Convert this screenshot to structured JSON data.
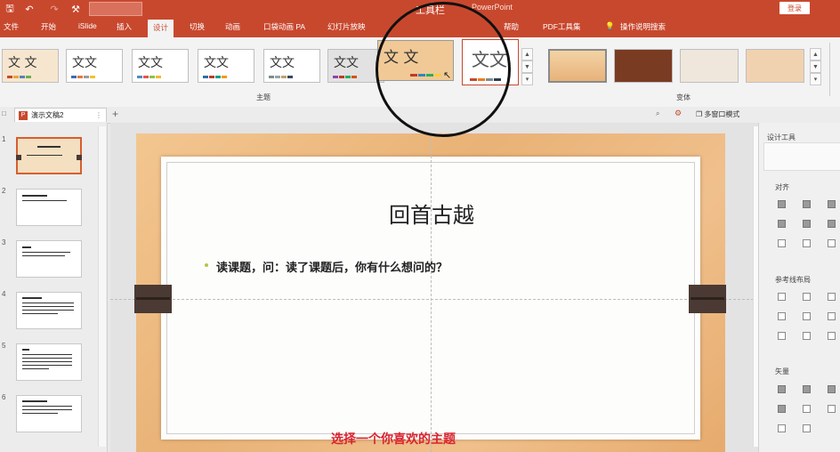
{
  "titlebar": {
    "tools_label": "工具栏",
    "app_name": "PowerPoint",
    "login_label": "登录",
    "quick_access": [
      "save-icon",
      "undo-icon",
      "redo-icon",
      "format-painter-icon"
    ]
  },
  "tabs": [
    {
      "label": "文件"
    },
    {
      "label": "开始"
    },
    {
      "label": "iSlide"
    },
    {
      "label": "插入"
    },
    {
      "label": "设计",
      "active": true
    },
    {
      "label": "切换"
    },
    {
      "label": "动画"
    },
    {
      "label": "口袋动画 PA"
    },
    {
      "label": "幻灯片放映"
    },
    {
      "label": "帮助"
    },
    {
      "label": "PDF工具集"
    },
    {
      "label": "操作说明搜索"
    }
  ],
  "ribbon": {
    "themes_group_label": "主题",
    "variants_group_label": "变体",
    "theme_sample_text": "文文",
    "theme_sample_alt": "文 文"
  },
  "document": {
    "tab_label": "演示文稿2",
    "view_label": "多窗口模式"
  },
  "slides": [
    {
      "num": "1"
    },
    {
      "num": "2"
    },
    {
      "num": "3"
    },
    {
      "num": "4"
    },
    {
      "num": "5"
    },
    {
      "num": "6"
    }
  ],
  "slide": {
    "title": "回首古越",
    "bullet": "读课题，问：读了课题后，你有什么想问的？"
  },
  "caption": "选择一个你喜欢的主题",
  "design_pane": {
    "title": "设计工具",
    "align_label": "对齐",
    "guides_label": "参考线布局",
    "vector_label": "矢量"
  },
  "colors": {
    "accent": "#c8482e",
    "caption": "#d8242f",
    "slide_bg": "#eab278"
  }
}
